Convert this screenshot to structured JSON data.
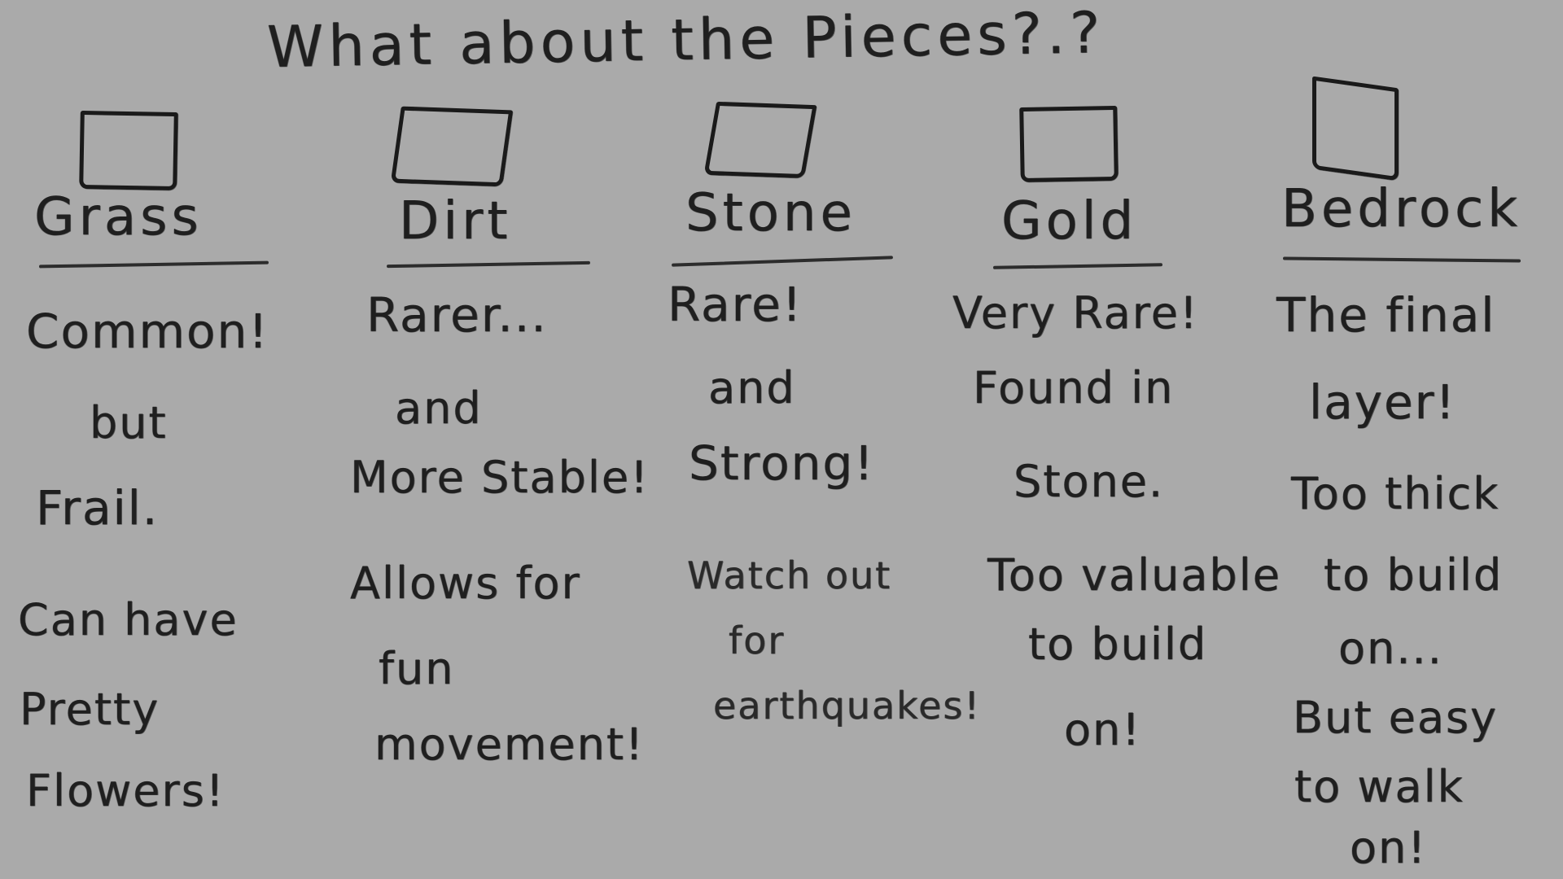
{
  "title": "What about the Pieces?.?",
  "pieces": [
    {
      "name": "Grass",
      "lines": [
        "Common!",
        "but",
        "Frail.",
        "Can have",
        "Pretty",
        "Flowers!"
      ]
    },
    {
      "name": "Dirt",
      "lines": [
        "Rarer...",
        "and",
        "More Stable!",
        "Allows for",
        "fun",
        "movement!"
      ]
    },
    {
      "name": "Stone",
      "lines": [
        "Rare!",
        "and",
        "Strong!",
        "Watch out",
        "for",
        "earthquakes!"
      ]
    },
    {
      "name": "Gold",
      "lines": [
        "Very Rare!",
        "Found in",
        "Stone.",
        "Too valuable",
        "to build",
        "on!"
      ]
    },
    {
      "name": "Bedrock",
      "lines": [
        "The final",
        "layer!",
        "Too thick",
        "to build",
        "on...",
        "But easy",
        "to walk",
        "on!"
      ]
    }
  ]
}
